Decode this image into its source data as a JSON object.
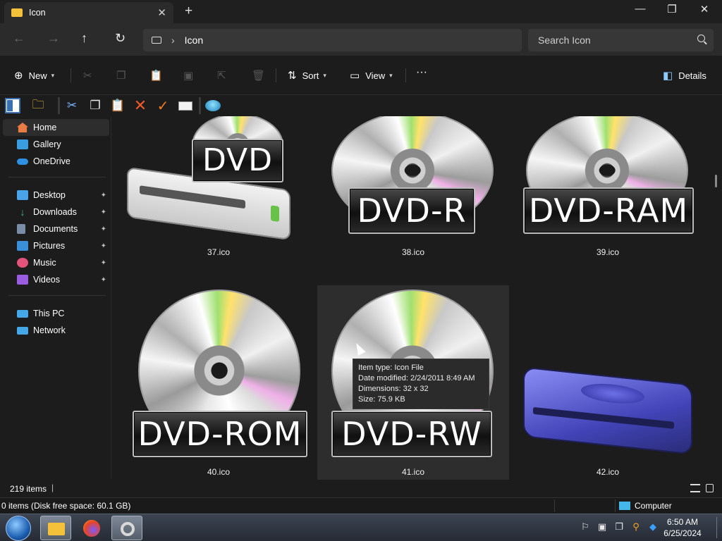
{
  "window": {
    "tab_title": "Icon",
    "new_tab_symbol": "+",
    "controls": {
      "minimize": "—",
      "maximize": "❐",
      "close": "✕"
    }
  },
  "nav": {
    "back_icon": "←",
    "forward_icon": "→",
    "up_icon": "↑",
    "refresh_icon": "↻",
    "breadcrumb": [
      "Icon"
    ],
    "search_placeholder": "Search Icon"
  },
  "commands": {
    "new_label": "New",
    "sort_label": "Sort",
    "view_label": "View",
    "more_label": "···",
    "details_label": "Details"
  },
  "sidebar": {
    "quick": [
      {
        "label": "Home",
        "icon": "home-icon",
        "color": "#e97b45",
        "active": true
      },
      {
        "label": "Gallery",
        "icon": "gallery-icon",
        "color": "#3a9de0"
      },
      {
        "label": "OneDrive",
        "icon": "onedrive-icon",
        "color": "#2f8fe0"
      }
    ],
    "pinned": [
      {
        "label": "Desktop",
        "icon": "desktop-icon",
        "color": "#4aa3e6"
      },
      {
        "label": "Downloads",
        "icon": "downloads-icon",
        "color": "#3dbd7d"
      },
      {
        "label": "Documents",
        "icon": "documents-icon",
        "color": "#7a8ca6"
      },
      {
        "label": "Pictures",
        "icon": "pictures-icon",
        "color": "#3b8fd8"
      },
      {
        "label": "Music",
        "icon": "music-icon",
        "color": "#e4547a"
      },
      {
        "label": "Videos",
        "icon": "videos-icon",
        "color": "#9b5de0"
      }
    ],
    "devices": [
      {
        "label": "This PC",
        "icon": "this-pc-icon",
        "color": "#45a7e8"
      },
      {
        "label": "Network",
        "icon": "network-icon",
        "color": "#45a7e8"
      }
    ],
    "pin_symbol": "📌"
  },
  "files": [
    {
      "name": "37.ico",
      "badge": "DVD"
    },
    {
      "name": "38.ico",
      "badge": "DVD-R"
    },
    {
      "name": "39.ico",
      "badge": "DVD-RAM"
    },
    {
      "name": "40.ico",
      "badge": "DVD-ROM"
    },
    {
      "name": "41.ico",
      "badge": "DVD-RW"
    },
    {
      "name": "42.ico",
      "badge": ""
    }
  ],
  "tooltip": {
    "type": "Item type: Icon File",
    "modified": "Date modified: 2/24/2011 8:49 AM",
    "dimensions": "Dimensions: 32 x 32",
    "size": "Size: 75.9 KB"
  },
  "status": {
    "items_count": "219 items",
    "count_sep": "|",
    "selection_info": "0 items (Disk free space: 60.1 GB)",
    "zone_label": "Computer"
  },
  "taskbar": {
    "time": "6:50 AM",
    "date": "6/25/2024"
  },
  "colors": {
    "accent": "#3a9de0",
    "folder": "#f3c13a"
  }
}
